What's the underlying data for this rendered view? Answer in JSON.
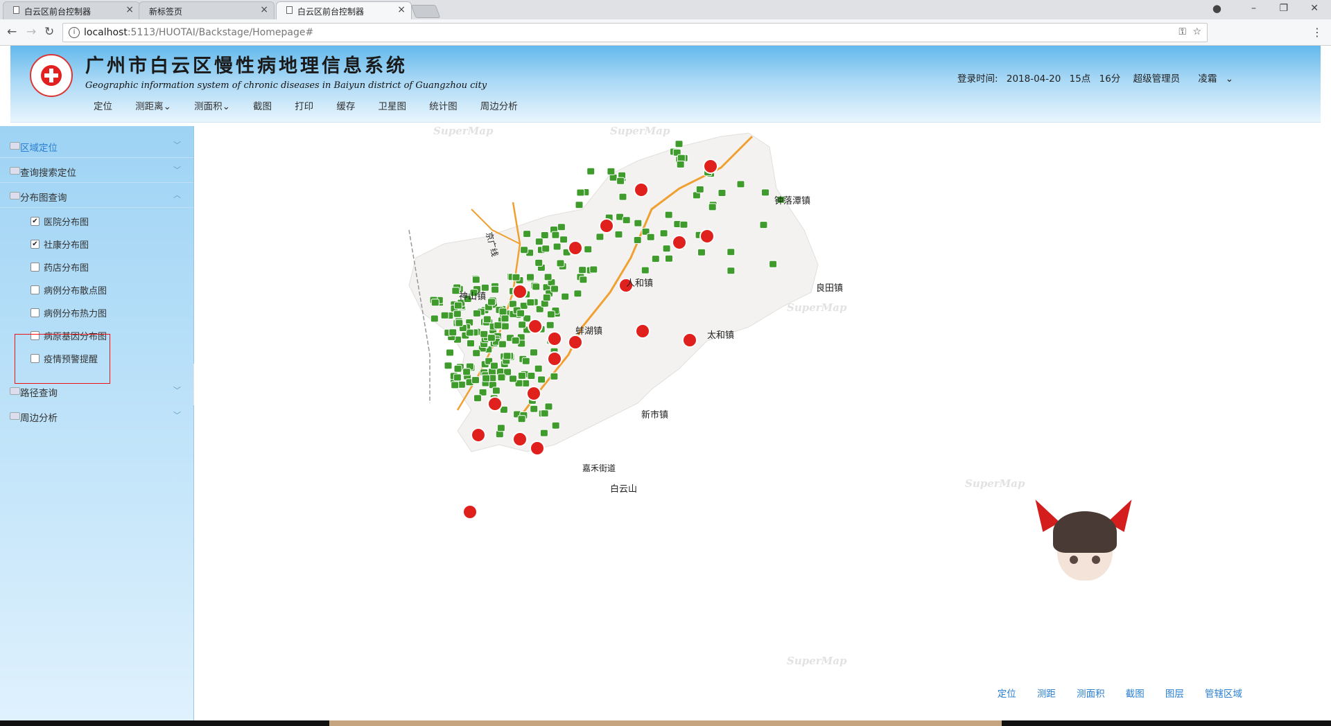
{
  "browser": {
    "tabs": [
      {
        "title": "白云区前台控制器",
        "close": "×",
        "active": false
      },
      {
        "title": "新标签页",
        "close": "×",
        "active": false
      },
      {
        "title": "白云区前台控制器",
        "close": "×",
        "active": true
      }
    ],
    "url_host": "localhost",
    "url_path": ":5113/HUOTAI/Backstage/Homepage#",
    "window_controls": [
      "–",
      "❐",
      "✕"
    ]
  },
  "header": {
    "title": "广州市白云区慢性病地理信息系统",
    "subtitle": "Geographic information system of chronic diseases in Baiyun district of Guangzhou city",
    "login_label": "登录时间:",
    "login_date": "2018-04-20",
    "login_hour": "15点",
    "login_minute": "16分",
    "role": "超级管理员",
    "user": "凌霜",
    "toolbar": [
      {
        "label": "定位"
      },
      {
        "label": "测距离"
      },
      {
        "label": "测面积"
      },
      {
        "label": "截图"
      },
      {
        "label": "打印"
      },
      {
        "label": "缓存"
      },
      {
        "label": "卫星图"
      },
      {
        "label": "统计图"
      },
      {
        "label": "周边分析"
      }
    ]
  },
  "sidebar": {
    "panels": [
      {
        "label": "区域定位",
        "expanded": false,
        "selected": true
      },
      {
        "label": "查询搜索定位",
        "expanded": false
      },
      {
        "label": "分布图查询",
        "expanded": true
      },
      {
        "label": "路径查询",
        "expanded": false
      },
      {
        "label": "周边分析",
        "expanded": false
      }
    ],
    "layers": [
      {
        "label": "医院分布图",
        "checked": true
      },
      {
        "label": "社康分布图",
        "checked": true
      },
      {
        "label": "药店分布图",
        "checked": false
      },
      {
        "label": "病例分布散点图",
        "checked": false
      },
      {
        "label": "病例分布热力图",
        "checked": false
      },
      {
        "label": "病原基因分布图",
        "checked": false
      },
      {
        "label": "疫情预警提醒",
        "checked": false
      }
    ]
  },
  "map": {
    "watermark": "SuperMap",
    "place_labels": [
      "钟落潭镇",
      "人和镇",
      "神山镇",
      "良田镇",
      "蚌湖镇",
      "太和镇",
      "新市镇",
      "白云山",
      "京广线",
      "嘉禾街道"
    ],
    "marker_colors": {
      "hospital": "#e0201c",
      "clinic": "#3e9b2c",
      "road": "#f0a030",
      "land": "#f3f2f0"
    },
    "footer": [
      {
        "label": "定位"
      },
      {
        "label": "测距"
      },
      {
        "label": "测面积"
      },
      {
        "label": "截图"
      },
      {
        "label": "图层"
      },
      {
        "label": "管辖区域"
      }
    ]
  }
}
